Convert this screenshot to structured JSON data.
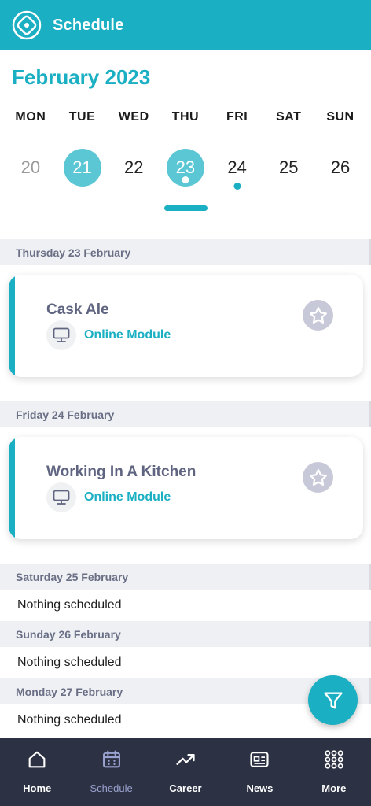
{
  "header": {
    "title": "Schedule",
    "logo_icon": "compass-logo-icon"
  },
  "calendar": {
    "month_label": "February 2023",
    "weekdays": [
      "MON",
      "TUE",
      "WED",
      "THU",
      "FRI",
      "SAT",
      "SUN"
    ],
    "days": [
      "20",
      "21",
      "22",
      "23",
      "24",
      "25",
      "26"
    ],
    "selected_day": "21",
    "today": "23",
    "days_with_events": [
      "23",
      "24"
    ]
  },
  "schedule": {
    "thursday": {
      "heading": "Thursday 23 February",
      "event": {
        "title": "Cask Ale",
        "type": "Online Module",
        "type_icon": "monitor-icon",
        "favorite_icon": "star-icon"
      }
    },
    "friday": {
      "heading": "Friday 24 February",
      "event": {
        "title": "Working In A Kitchen",
        "type": "Online Module",
        "type_icon": "monitor-icon",
        "favorite_icon": "star-icon"
      }
    },
    "saturday": {
      "heading": "Saturday 25 February",
      "empty": "Nothing scheduled"
    },
    "sunday": {
      "heading": "Sunday 26 February",
      "empty": "Nothing scheduled"
    },
    "monday": {
      "heading": "Monday 27 February",
      "empty": "Nothing scheduled"
    }
  },
  "filter_button": {
    "icon": "filter-icon"
  },
  "nav": {
    "home": "Home",
    "schedule": "Schedule",
    "career": "Career",
    "news": "News",
    "more": "More",
    "active": "schedule"
  },
  "colors": {
    "accent": "#1aafc2",
    "selected_day": "#5bc7d4",
    "nav_bg": "#2c3144",
    "nav_active": "#9aa2cf"
  }
}
